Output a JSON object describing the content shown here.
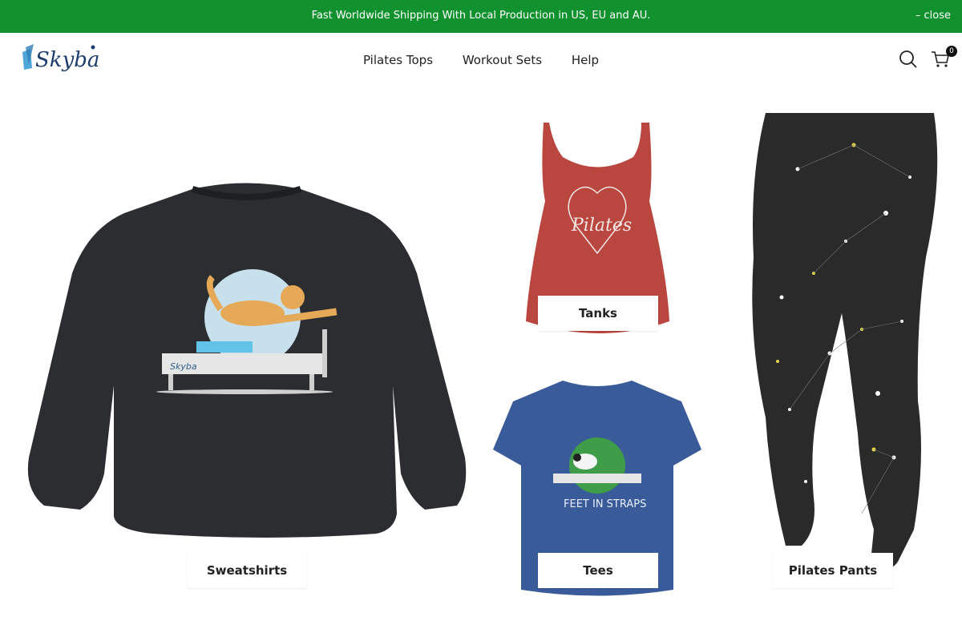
{
  "announcement": {
    "message": "Fast Worldwide Shipping With Local Production in US, EU and AU.",
    "close_label": "– close"
  },
  "header": {
    "logo_text": "Skyba",
    "nav": [
      "Pilates Tops",
      "Workout Sets",
      "Help"
    ],
    "cart_count": "0",
    "icons": [
      "search-icon",
      "cart-icon"
    ]
  },
  "collections": [
    {
      "label": "Sweatshirts",
      "garment_color": "#2b2d30",
      "print_text": "Skyba"
    },
    {
      "label": "Tanks",
      "garment_color": "#b9463f",
      "print_text": "Pilates"
    },
    {
      "label": "Tees",
      "garment_color": "#3a5b9a",
      "print_text": "FEET IN STRAPS"
    },
    {
      "label": "Pilates Pants",
      "garment_color": "#2a2a2a"
    }
  ],
  "colors": {
    "announcement_bg": "#12922f",
    "announcement_text": "#ffffff",
    "text": "#222222"
  }
}
